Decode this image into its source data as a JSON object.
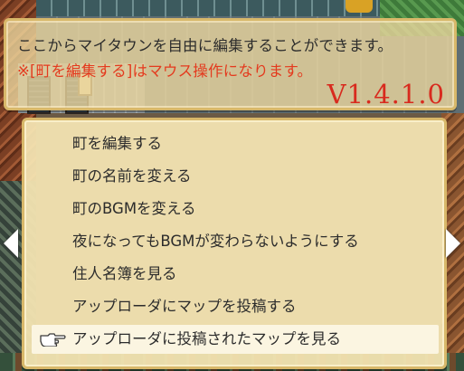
{
  "help": {
    "line1": "ここからマイタウンを自由に編集することができます。",
    "line2": "※[町を編集する]はマウス操作になります。",
    "version": "V1.4.1.0"
  },
  "menu": {
    "items": [
      {
        "label": "町を編集する"
      },
      {
        "label": "町の名前を変える"
      },
      {
        "label": "町のBGMを変える"
      },
      {
        "label": "夜になってもBGMが変わらないようにする"
      },
      {
        "label": "住人名簿を見る"
      },
      {
        "label": "アップローダにマップを投稿する"
      },
      {
        "label": "アップローダに投稿されたマップを見る"
      }
    ],
    "selected_index": 6,
    "cursor_icon": "pointing-hand-icon"
  },
  "colors": {
    "help_text": "#2c2c2c",
    "note_text": "#e43a1e",
    "version_text": "#d82a1e",
    "window_bg": "#f4e4b2",
    "window_border": "#d8b86a"
  }
}
